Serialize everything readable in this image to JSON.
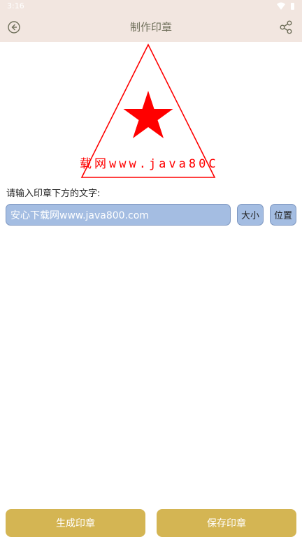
{
  "status_bar": {
    "time": "3:16",
    "icons": [
      "wifi-icon",
      "battery-icon"
    ]
  },
  "app_bar": {
    "title": "制作印章",
    "back_icon": "back-circle-icon",
    "share_icon": "share-icon"
  },
  "seal": {
    "shape": "triangle",
    "star_icon": "star-icon",
    "text": "安心下载网www.java800.com",
    "visible_text": "载网www.java80C",
    "color": "#ff0000"
  },
  "form": {
    "prompt_label": "请输入印章下方的文字:",
    "input_value": "安心下载网www.java800.com",
    "size_button": "大小",
    "position_button": "位置"
  },
  "actions": {
    "generate_label": "生成印章",
    "save_label": "保存印章"
  },
  "colors": {
    "app_bar_bg": "#f2e6e0",
    "input_bg": "#a4bde2",
    "action_button_bg": "#d4b553",
    "seal_red": "#ff0000"
  }
}
